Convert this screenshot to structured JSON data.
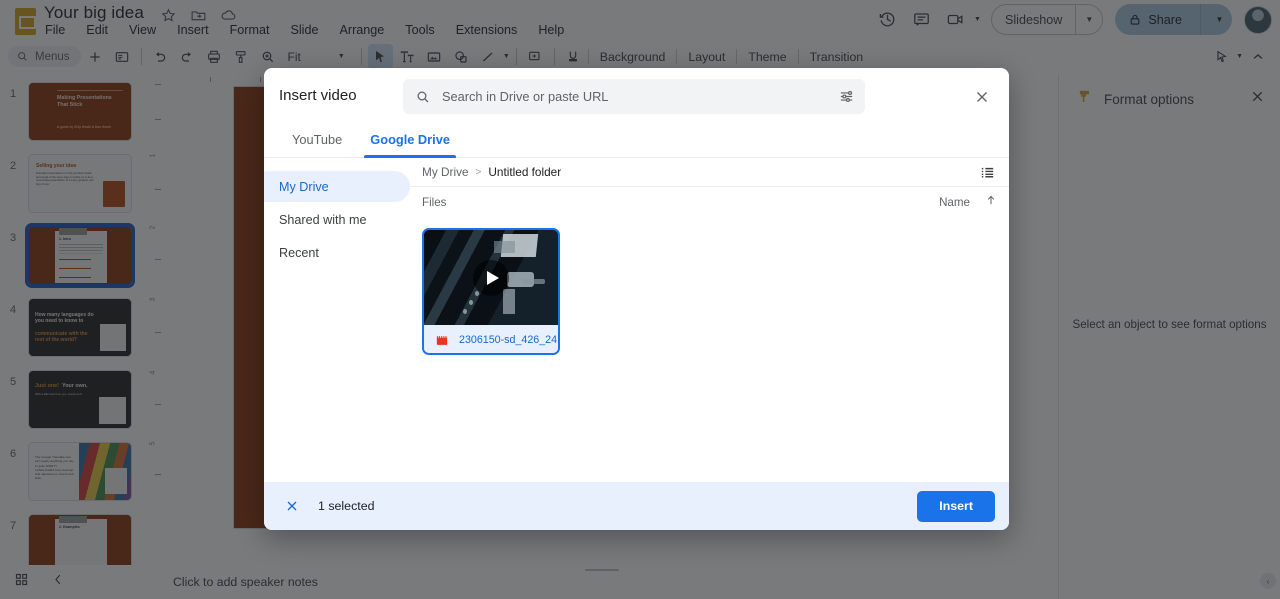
{
  "app": {
    "doc_title": "Your big idea",
    "logo_icon": "slides-logo-icon",
    "title_icons": [
      "star-icon",
      "move-to-folder-icon",
      "cloud-saved-icon"
    ],
    "menus": [
      "File",
      "Edit",
      "View",
      "Insert",
      "Format",
      "Slide",
      "Arrange",
      "Tools",
      "Extensions",
      "Help"
    ],
    "header_right": {
      "history_icon": "version-history-icon",
      "comment_icon": "comment-icon",
      "meet_icon": "video-camera-icon",
      "slideshow_label": "Slideshow",
      "share_label": "Share",
      "share_lock_icon": "lock-icon",
      "avatar": "user-avatar"
    }
  },
  "toolbar": {
    "menus_label": "Menus",
    "search_icon": "search-icon",
    "zoom_value": "Fit",
    "items": [
      "new-slide-icon",
      "layout-icon",
      "undo-icon",
      "redo-icon",
      "print-icon",
      "paint-format-icon",
      "zoom-icon",
      "cursor-icon",
      "text-box-icon",
      "image-icon",
      "shape-icon",
      "line-icon",
      "table-icon",
      "ink-icon"
    ],
    "text_buttons": [
      "Background",
      "Layout",
      "Theme",
      "Transition"
    ],
    "right_icons": [
      "select-mode-icon",
      "collapse-toolbar-icon"
    ]
  },
  "thumbnails": [
    {
      "number": "1",
      "style": "orange",
      "title": "Making Presentations That Stick",
      "subtitle": "A guide by Chip Heath & Dan Heath"
    },
    {
      "number": "2",
      "style": "white",
      "title": "Selling your idea",
      "body": "Dramatic presentations to help you floor heads and speak of the same way to inspire us to be a memorable presentation of it many greatest, win big or bust."
    },
    {
      "number": "3",
      "style": "orange",
      "selected": true,
      "title": "1. Intro"
    },
    {
      "number": "4",
      "style": "dark",
      "title": "How many languages do you need to know to",
      "accent": "communicate with the rest of the world?"
    },
    {
      "number": "5",
      "style": "dark",
      "accent": "Just one!",
      "title": "Your own.",
      "body": "With a little help from you, would you?"
    },
    {
      "number": "6",
      "style": "white",
      "body": "The Google Translate can turn nearly anything you say in quite NINETY LANGUAGES from German and Japanese to Czech and Zulu."
    },
    {
      "number": "7",
      "style": "orange",
      "title": "2. Examples"
    }
  ],
  "bottom_bar": {
    "grid_view_icon": "grid-view-icon",
    "collapse_icon": "chevron-left-icon",
    "speaker_notes_placeholder": "Click to add speaker notes"
  },
  "format_panel": {
    "icon": "paint-roller-icon",
    "title": "Format options",
    "close_icon": "close-icon",
    "empty_message": "Select an object to see format options"
  },
  "ruler": {
    "vertical_labels": [
      "1",
      "2",
      "3",
      "4",
      "5"
    ]
  },
  "dialog": {
    "title": "Insert video",
    "search_placeholder": "Search in Drive or paste URL",
    "search_value": "",
    "search_icon": "search-icon",
    "tune_icon": "tune-icon",
    "close_icon": "close-icon",
    "tabs": [
      {
        "label": "YouTube",
        "active": false
      },
      {
        "label": "Google Drive",
        "active": true
      }
    ],
    "nav": [
      {
        "label": "My Drive",
        "active": true
      },
      {
        "label": "Shared with me",
        "active": false
      },
      {
        "label": "Recent",
        "active": false
      }
    ],
    "breadcrumb": {
      "root": "My Drive",
      "separator": ">",
      "current": "Untitled folder"
    },
    "list_view_icon": "list-view-icon",
    "files_label": "Files",
    "sort_label": "Name",
    "sort_direction_icon": "arrow-up-icon",
    "files": [
      {
        "name": "2306150-sd_426_24…",
        "type_icon": "video-file-icon",
        "selected": true,
        "play_icon": "play-icon"
      }
    ],
    "footer": {
      "clear_icon": "close-icon",
      "selection_text": "1 selected",
      "insert_label": "Insert"
    }
  },
  "colors": {
    "accent_blue": "#1a73e8",
    "selected_bg": "#e8f0fe",
    "slide_orange": "#8a3309",
    "slides_yellow": "#d4a017",
    "share_blue": "#a8c7e0"
  }
}
